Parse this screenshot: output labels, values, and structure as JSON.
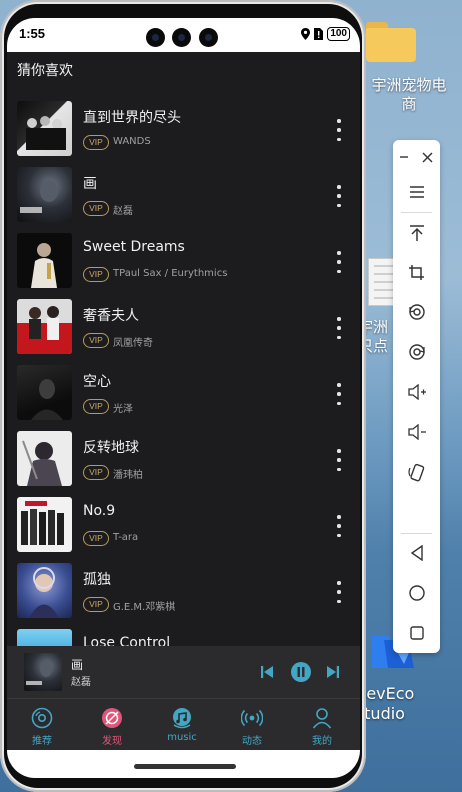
{
  "desktop": {
    "folder_label_lines": [
      "宇洲宠物电",
      "商"
    ],
    "doc_label_lines": [
      "宇洲",
      "只点"
    ],
    "deveco_label_lines": [
      "DevEco",
      "Studio"
    ]
  },
  "status_bar": {
    "time": "1:55",
    "battery": "100"
  },
  "section_title": "猜你喜欢",
  "vip_label": "VIP",
  "songs": [
    {
      "title": "直到世界的尽头",
      "artist": "WANDS",
      "cover_colors": [
        "#1a1a1a",
        "#d8d8d8"
      ]
    },
    {
      "title": "画",
      "artist": "赵磊",
      "cover_colors": [
        "#14161a",
        "#6a7484"
      ]
    },
    {
      "title": "Sweet Dreams",
      "artist": "TPaul Sax / Eurythmics",
      "cover_colors": [
        "#0c0c0c",
        "#c9c2b8"
      ]
    },
    {
      "title": "奢香夫人",
      "artist": "凤凰传奇",
      "cover_colors": [
        "#d8d8d8",
        "#c0191f"
      ]
    },
    {
      "title": "空心",
      "artist": "光泽",
      "cover_colors": [
        "#111111",
        "#3a3a3a"
      ]
    },
    {
      "title": "反转地球",
      "artist": "潘玮柏",
      "cover_colors": [
        "#e9e9e9",
        "#3d3a44"
      ]
    },
    {
      "title": "No.9",
      "artist": "T-ara",
      "cover_colors": [
        "#efefef",
        "#222222"
      ]
    },
    {
      "title": "孤独",
      "artist": "G.E.M.邓紫棋",
      "cover_colors": [
        "#2a3d7a",
        "#b7c1e2"
      ]
    },
    {
      "title": "Lose Control",
      "artist": "",
      "cover_colors": [
        "#2a9fd8",
        "#7fd0f1"
      ]
    }
  ],
  "now_playing": {
    "title": "画",
    "artist": "赵磊"
  },
  "tabs": [
    {
      "label": "推荐",
      "icon": "disc-icon",
      "active": false
    },
    {
      "label": "发现",
      "icon": "discover-icon",
      "active": true
    },
    {
      "label": "music",
      "icon": "music-cloud-icon",
      "active": false
    },
    {
      "label": "动态",
      "icon": "broadcast-icon",
      "active": false
    },
    {
      "label": "我的",
      "icon": "person-icon",
      "active": false
    }
  ],
  "colors": {
    "accent": "#43a7c4",
    "active_tab": "#e0567b",
    "vip": "#c9a865"
  }
}
